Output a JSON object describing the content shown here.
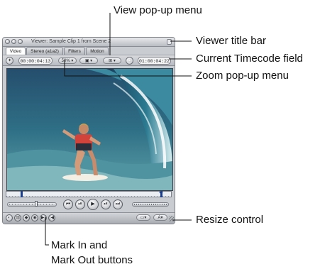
{
  "callouts": {
    "view_popup": "View pop-up menu",
    "viewer_title_bar": "Viewer title bar",
    "current_timecode": "Current Timecode field",
    "zoom_popup": "Zoom pop-up menu",
    "resize_control": "Resize control",
    "mark_in_out_line1": "Mark In and",
    "mark_in_out_line2": "Mark Out buttons"
  },
  "viewer": {
    "title": "Viewer: Sample Clip 1 from Scene 2",
    "tabs": [
      {
        "label": "Video",
        "active": true
      },
      {
        "label": "Stereo (a1a2)",
        "active": false
      },
      {
        "label": "Filters",
        "active": false
      },
      {
        "label": "Motion",
        "active": false
      }
    ],
    "duration_timecode": "00:00:04:13",
    "zoom_value": "50%",
    "view_popup_icon": "view-options-icon",
    "current_timecode": "01:00:04:22"
  },
  "colors": {
    "window_bg": "#c9ccd1",
    "scrubber_bg": "#ebeef3",
    "playhead": "#1b3f8c"
  }
}
